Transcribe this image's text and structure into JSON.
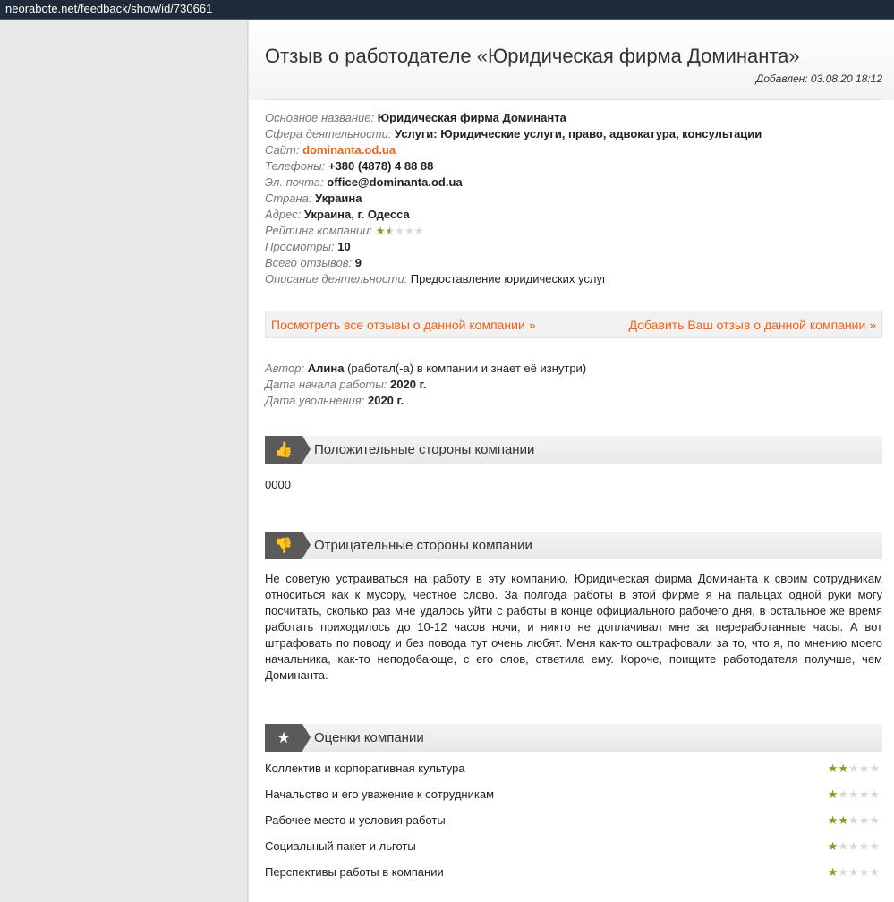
{
  "browser": {
    "url": "neorabote.net/feedback/show/id/730661"
  },
  "page": {
    "title": "Отзыв о работодателе «Юридическая фирма Доминанта»",
    "added": "Добавлен: 03.08.20 18:12"
  },
  "company": {
    "name_label": "Основное название:",
    "name": "Юридическая фирма Доминанта",
    "sphere_label": "Сфера деятельности:",
    "sphere": "Услуги: Юридические услуги, право, адвокатура, консультации",
    "site_label": "Сайт:",
    "site": "dominanta.od.ua",
    "phones_label": "Телефоны:",
    "phones": "+380 (4878) 4 88 88",
    "email_label": "Эл. почта:",
    "email": "office@dominanta.od.ua",
    "country_label": "Страна:",
    "country": "Украина",
    "address_label": "Адрес:",
    "address": "Украина, г. Одесса",
    "rating_label": "Рейтинг компании:",
    "rating": 1.5,
    "views_label": "Просмотры:",
    "views": "10",
    "reviews_label": "Всего отзывов:",
    "reviews": "9",
    "description_label": "Описание деятельности:",
    "description": "Предоставление юридических услуг"
  },
  "links": {
    "all_reviews": "Посмотреть все отзывы о данной компании »",
    "add_review": "Добавить Ваш отзыв о данной компании »"
  },
  "author": {
    "author_label": "Автор:",
    "name": "Алина",
    "note": "(работал(-а) в компании и знает её изнутри)",
    "start_label": "Дата начала работы:",
    "start": "2020 г.",
    "end_label": "Дата увольнения:",
    "end": "2020 г."
  },
  "positive": {
    "icon": "thumbs-up-icon",
    "title": "Положительные стороны компании",
    "text": "0000"
  },
  "negative": {
    "icon": "thumbs-down-icon",
    "title": "Отрицательные стороны компании",
    "text": "Не советую устраиваться на работу в эту компанию. Юридическая фирма Доминанта к своим сотрудникам относиться как к мусору, честное слово. За полгода работы в этой фирме я на пальцах одной руки могу посчитать, сколько раз мне удалось уйти с работы в конце официального рабочего дня, в остальное же время работать приходилось до 10-12 часов ночи, и никто не доплачивал мне за переработанные часы. А вот штрафовать по поводу и без повода тут очень любят. Меня как-то оштрафовали за то, что я, по мнению моего начальника, как-то неподобающе, с его слов, ответила ему. Короче, поищите работодателя получше, чем Доминанта."
  },
  "ratings": {
    "icon": "star-icon",
    "title": "Оценки компании",
    "items": [
      {
        "label": "Коллектив и корпоративная культура",
        "stars": 2
      },
      {
        "label": "Начальство и его уважение к сотрудникам",
        "stars": 1
      },
      {
        "label": "Рабочее место и условия работы",
        "stars": 2
      },
      {
        "label": "Социальный пакет и льготы",
        "stars": 1
      },
      {
        "label": "Перспективы работы в компании",
        "stars": 1
      }
    ]
  },
  "colors": {
    "accent": "#e8631c",
    "star": "#8a9a1f",
    "star_empty": "#d8d8d8",
    "section_icon_bg": "#5a5a5a"
  }
}
